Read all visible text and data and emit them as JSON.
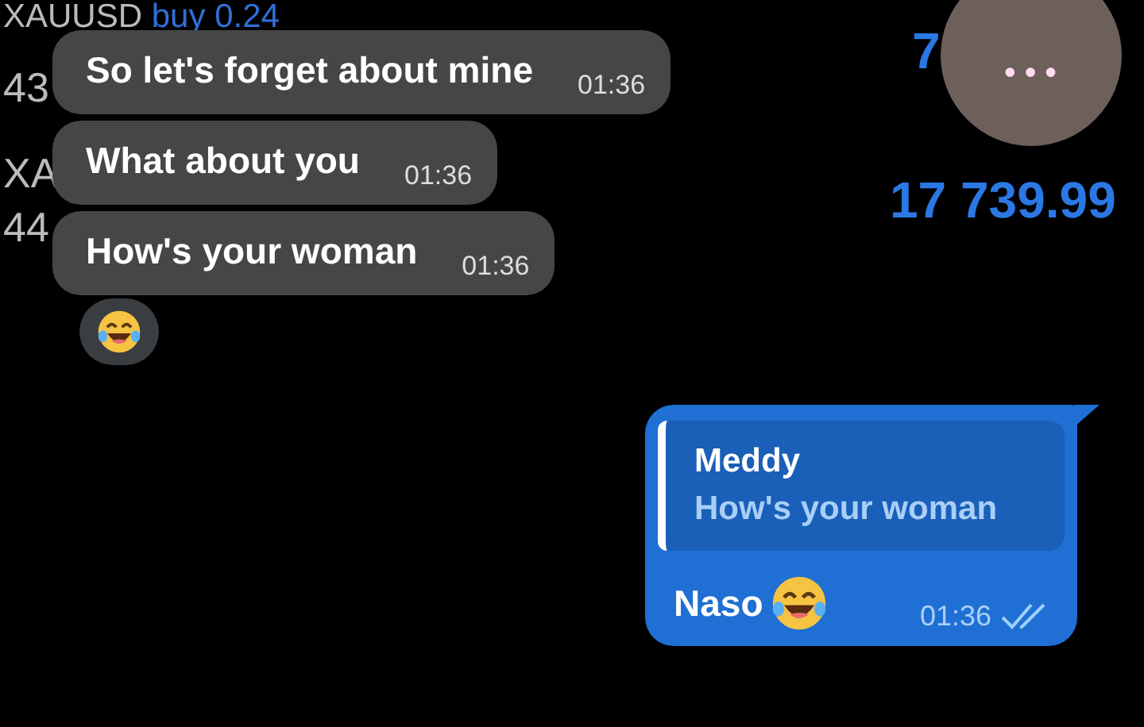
{
  "background_ticker": {
    "symbol": "XAUUSD",
    "order": "buy 0.24",
    "price_1": "43",
    "symbol_2": "XA",
    "price_2": "44",
    "value_1": "7",
    "value_2": "17 739.99"
  },
  "incoming": [
    {
      "text": "So let's forget about mine",
      "time": "01:36"
    },
    {
      "text": "What about you",
      "time": "01:36"
    },
    {
      "text": "How's your woman",
      "time": "01:36"
    }
  ],
  "reaction": {
    "kind": "laughing"
  },
  "outgoing": {
    "reply": {
      "author": "Meddy",
      "text": "How's your woman"
    },
    "text": "Naso",
    "time": "01:36",
    "read": true
  },
  "more_button": {
    "label": "•••"
  }
}
